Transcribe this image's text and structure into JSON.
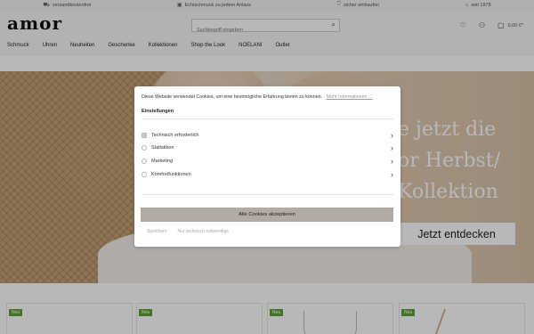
{
  "infobar": {
    "items": [
      {
        "icon": "truck-icon",
        "label": "versandkostenfrei"
      },
      {
        "icon": "gift-icon",
        "label": "Echtschmuck zu jedem Anlass"
      },
      {
        "icon": "shield-icon",
        "label": "sicher einkaufen"
      },
      {
        "icon": "shop-icon",
        "label": "seit 1978"
      }
    ]
  },
  "header": {
    "logo": "amor",
    "search_placeholder": "Suchbegriff eingeben",
    "cart_amount": "0,00 €*"
  },
  "nav": {
    "items": [
      "Schmuck",
      "Uhren",
      "Neuheiten",
      "Geschenke",
      "Kollektionen",
      "Shop the Look",
      "NOELANI",
      "Outlet"
    ]
  },
  "hero": {
    "headline_line1": "e jetzt die",
    "headline_line2": "or Herbst/",
    "headline_line3": "Kollektion",
    "cta": "Jetzt entdecken"
  },
  "products": {
    "badge": "Neu"
  },
  "cookie_modal": {
    "message": "Diese Website verwendet Cookies, um eine bestmögliche Erfahrung bieten zu können.",
    "more_info": "Mehr Informationen ...",
    "settings_title": "Einstellungen",
    "options": [
      {
        "label": "Technisch erforderlich",
        "checked": true
      },
      {
        "label": "Statistiken",
        "checked": false
      },
      {
        "label": "Marketing",
        "checked": false
      },
      {
        "label": "Komfortfunktionen",
        "checked": false
      }
    ],
    "accept_all": "Alle Cookies akzeptieren",
    "save": "Speichern",
    "only_necessary": "Nur technisch notwendige"
  }
}
